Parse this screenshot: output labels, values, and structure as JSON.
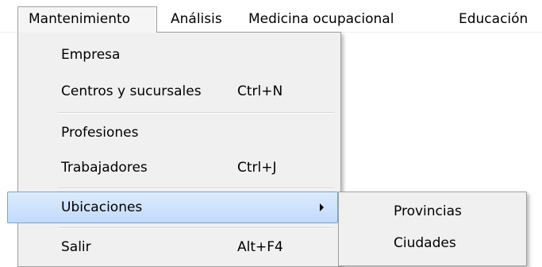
{
  "menubar": {
    "items": [
      {
        "label": "Mantenimiento"
      },
      {
        "label": "Análisis"
      },
      {
        "label": "Medicina ocupacional"
      },
      {
        "label": "Educación"
      }
    ]
  },
  "dropdown": {
    "items": [
      {
        "label": "Empresa",
        "shortcut": ""
      },
      {
        "label": "Centros y sucursales",
        "shortcut": "Ctrl+N"
      },
      {
        "label": "Profesiones",
        "shortcut": ""
      },
      {
        "label": "Trabajadores",
        "shortcut": "Ctrl+J"
      },
      {
        "label": "Ubicaciones",
        "shortcut": ""
      },
      {
        "label": "Salir",
        "shortcut": "Alt+F4"
      }
    ]
  },
  "submenu": {
    "items": [
      {
        "label": "Provincias"
      },
      {
        "label": "Ciudades"
      }
    ]
  },
  "colors": {
    "menu_background": "#f0f0f0",
    "highlight_border": "#7da2ce",
    "highlight_fill": "#c1dbfc"
  }
}
